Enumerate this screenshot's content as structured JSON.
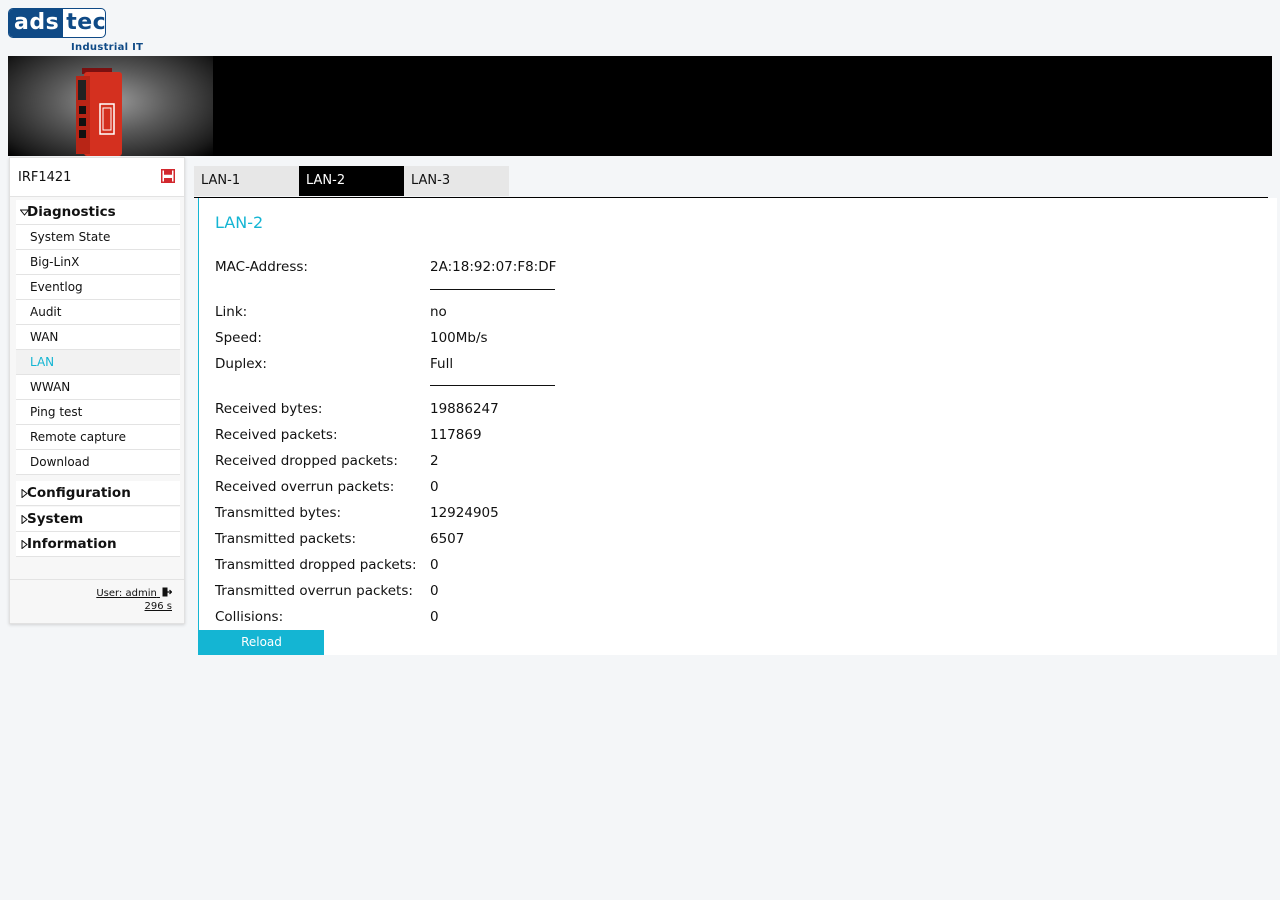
{
  "brand": {
    "logo_left": "ads",
    "logo_right": "tec",
    "tagline": "Industrial IT"
  },
  "sidebar": {
    "device_name": "IRF1421",
    "sections": [
      {
        "label": "Diagnostics",
        "expanded": true
      },
      {
        "label": "Configuration",
        "expanded": false
      },
      {
        "label": "System",
        "expanded": false
      },
      {
        "label": "Information",
        "expanded": false
      }
    ],
    "items": [
      {
        "label": "System State"
      },
      {
        "label": "Big-LinX"
      },
      {
        "label": "Eventlog"
      },
      {
        "label": "Audit"
      },
      {
        "label": "WAN"
      },
      {
        "label": "LAN",
        "active": true
      },
      {
        "label": "WWAN"
      },
      {
        "label": "Ping test"
      },
      {
        "label": "Remote capture"
      },
      {
        "label": "Download"
      }
    ],
    "user_label": "User: admin",
    "session_timer": "296 s"
  },
  "tabs": [
    {
      "label": "LAN-1"
    },
    {
      "label": "LAN-2",
      "active": true
    },
    {
      "label": "LAN-3"
    }
  ],
  "panel": {
    "title": "LAN-2",
    "fields": [
      {
        "label": "MAC-Address:",
        "value": "2A:18:92:07:F8:DF"
      },
      {
        "label": "Link:",
        "value": "no"
      },
      {
        "label": "Speed:",
        "value": "100Mb/s"
      },
      {
        "label": "Duplex:",
        "value": "Full"
      },
      {
        "label": "Received bytes:",
        "value": "19886247"
      },
      {
        "label": "Received packets:",
        "value": "117869"
      },
      {
        "label": "Received dropped packets:",
        "value": "2"
      },
      {
        "label": "Received overrun packets:",
        "value": "0"
      },
      {
        "label": "Transmitted bytes:",
        "value": "12924905"
      },
      {
        "label": "Transmitted packets:",
        "value": "6507"
      },
      {
        "label": "Transmitted dropped packets:",
        "value": "0"
      },
      {
        "label": "Transmitted overrun packets:",
        "value": "0"
      },
      {
        "label": "Collisions:",
        "value": "0"
      }
    ],
    "reload_label": "Reload"
  },
  "colors": {
    "accent": "#14b5d3",
    "brand": "#0f4a86",
    "save_icon": "#d2282e"
  }
}
